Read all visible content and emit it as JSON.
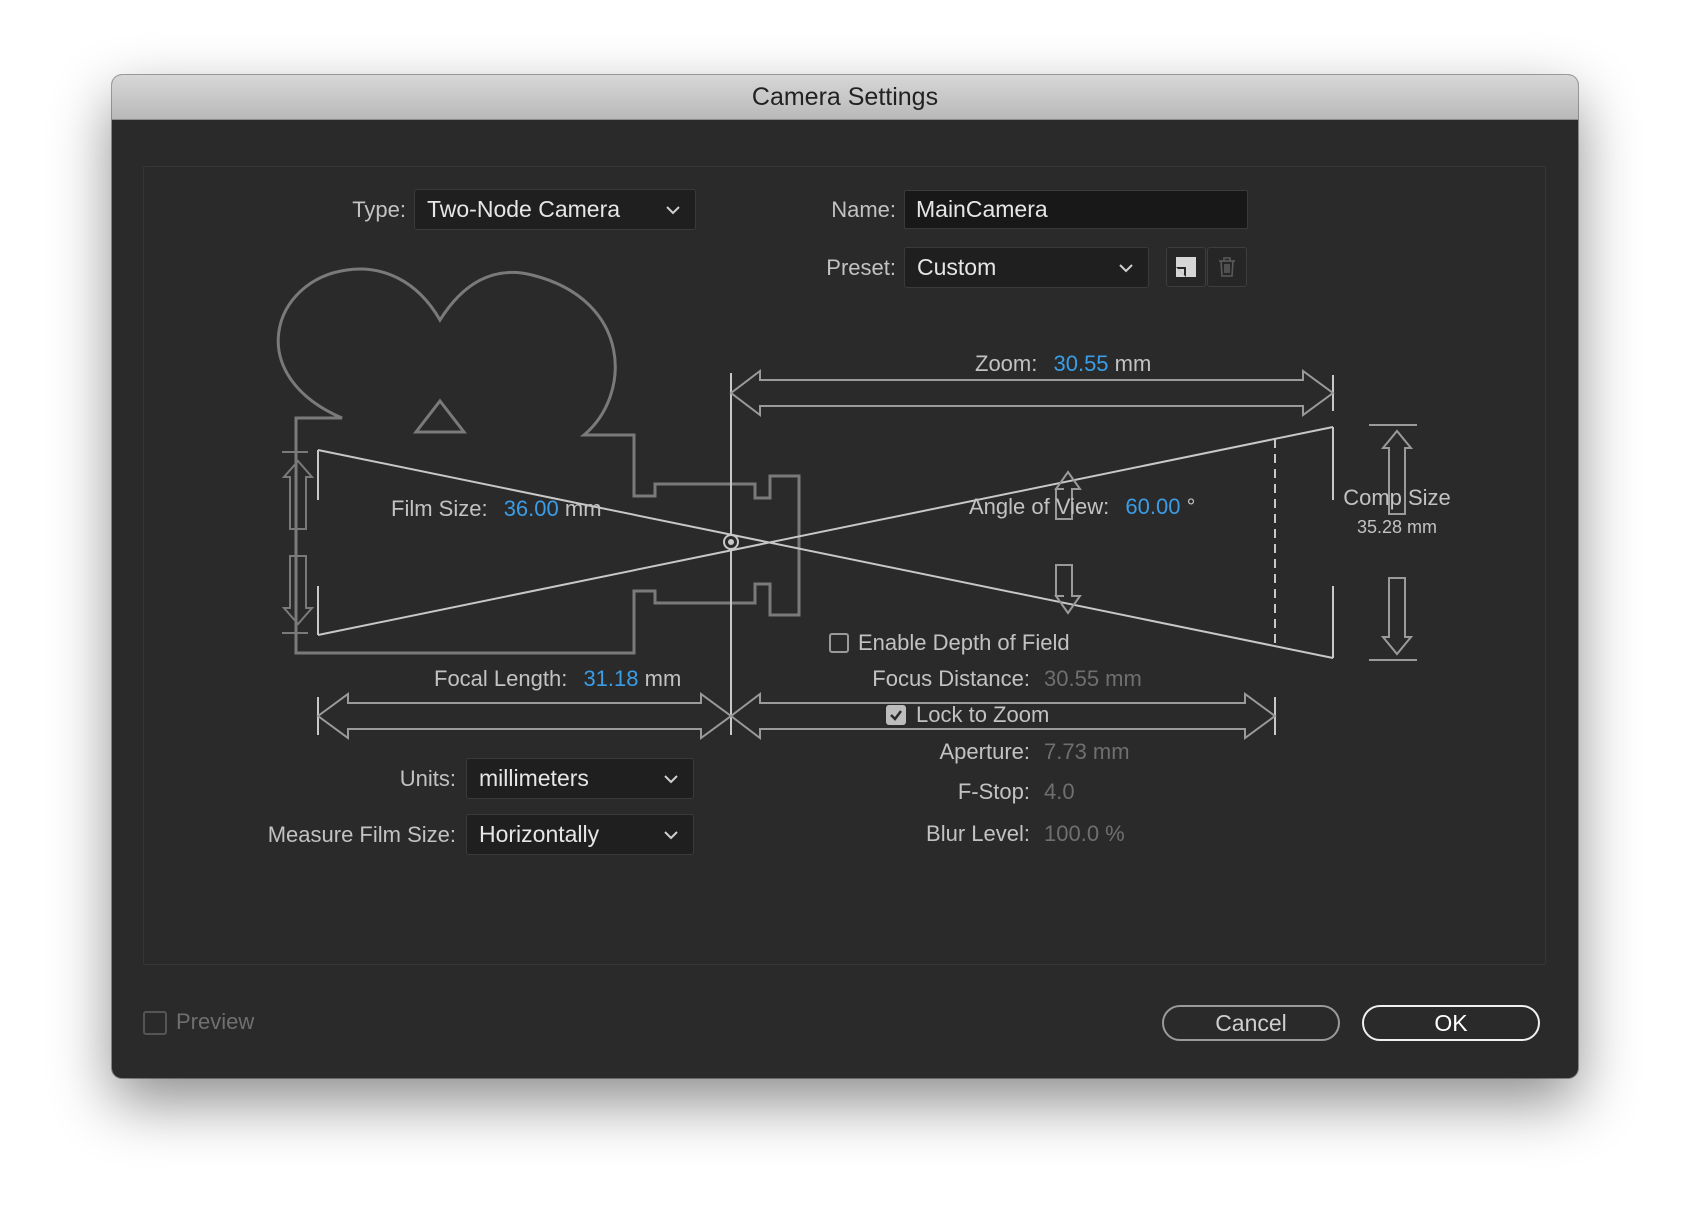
{
  "window": {
    "title": "Camera Settings"
  },
  "type": {
    "label": "Type:",
    "value": "Two-Node Camera"
  },
  "name": {
    "label": "Name:",
    "value": "MainCamera"
  },
  "preset": {
    "label": "Preset:",
    "value": "Custom",
    "save_icon": "save-preset-icon",
    "delete_icon": "trash-icon"
  },
  "zoom": {
    "label": "Zoom:",
    "value": "30.55",
    "unit": "mm"
  },
  "film_size": {
    "label": "Film Size:",
    "value": "36.00",
    "unit": "mm"
  },
  "angle_of_view": {
    "label": "Angle of View:",
    "value": "60.00",
    "unit": "°"
  },
  "comp_size": {
    "label": "Comp Size",
    "value": "35.28 mm"
  },
  "depth_of_field": {
    "label": "Enable Depth of Field",
    "checked": false
  },
  "focal_length": {
    "label": "Focal Length:",
    "value": "31.18",
    "unit": "mm"
  },
  "focus_distance": {
    "label": "Focus Distance:",
    "value": "30.55 mm"
  },
  "lock_to_zoom": {
    "label": "Lock to Zoom",
    "checked": true
  },
  "aperture": {
    "label": "Aperture:",
    "value": "7.73 mm"
  },
  "fstop": {
    "label": "F-Stop:",
    "value": "4.0"
  },
  "blur_level": {
    "label": "Blur Level:",
    "value": "100.0 %"
  },
  "units": {
    "label": "Units:",
    "value": "millimeters"
  },
  "measure_film_size": {
    "label": "Measure Film Size:",
    "value": "Horizontally"
  },
  "preview": {
    "label": "Preview",
    "checked": false
  },
  "buttons": {
    "cancel": "Cancel",
    "ok": "OK"
  },
  "colors": {
    "accent": "#3a9de6",
    "background": "#2a2a2a",
    "line": "#7a7a7a"
  }
}
